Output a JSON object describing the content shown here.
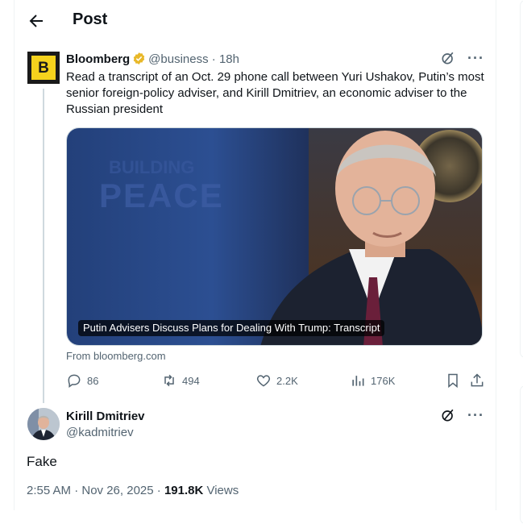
{
  "header": {
    "title": "Post",
    "back_icon": "arrow-left-icon"
  },
  "tweet": {
    "author_name": "Bloomberg",
    "avatar_letter": "B",
    "verified_color": "#e8b829",
    "handle": "@business",
    "separator": "·",
    "time": "18h",
    "text": "Read a transcript of an Oct. 29 phone call between Yuri Ushakov, Putin’s most senior foreign-policy adviser, and Kirill Dmitriev, an economic adviser to the Russian president",
    "media": {
      "background_text_top": "BUILDING",
      "background_text": "PEACE",
      "caption": "Putin Advisers Discuss Plans for Dealing With Trump: Transcript"
    },
    "source": "From bloomberg.com",
    "replies": "86",
    "reposts": "494",
    "likes": "2.2K",
    "views": "176K"
  },
  "reply": {
    "author_name": "Kirill Dmitriev",
    "handle": "@kadmitriev",
    "text": "Fake",
    "time": "2:55 AM · Nov 26, 2025 · ",
    "views_count": "191.8K",
    "views_label": " Views"
  },
  "colors": {
    "muted": "#536471",
    "text": "#0f1419",
    "border": "#eff3f4",
    "bloomberg_yellow": "#f5d21d"
  }
}
